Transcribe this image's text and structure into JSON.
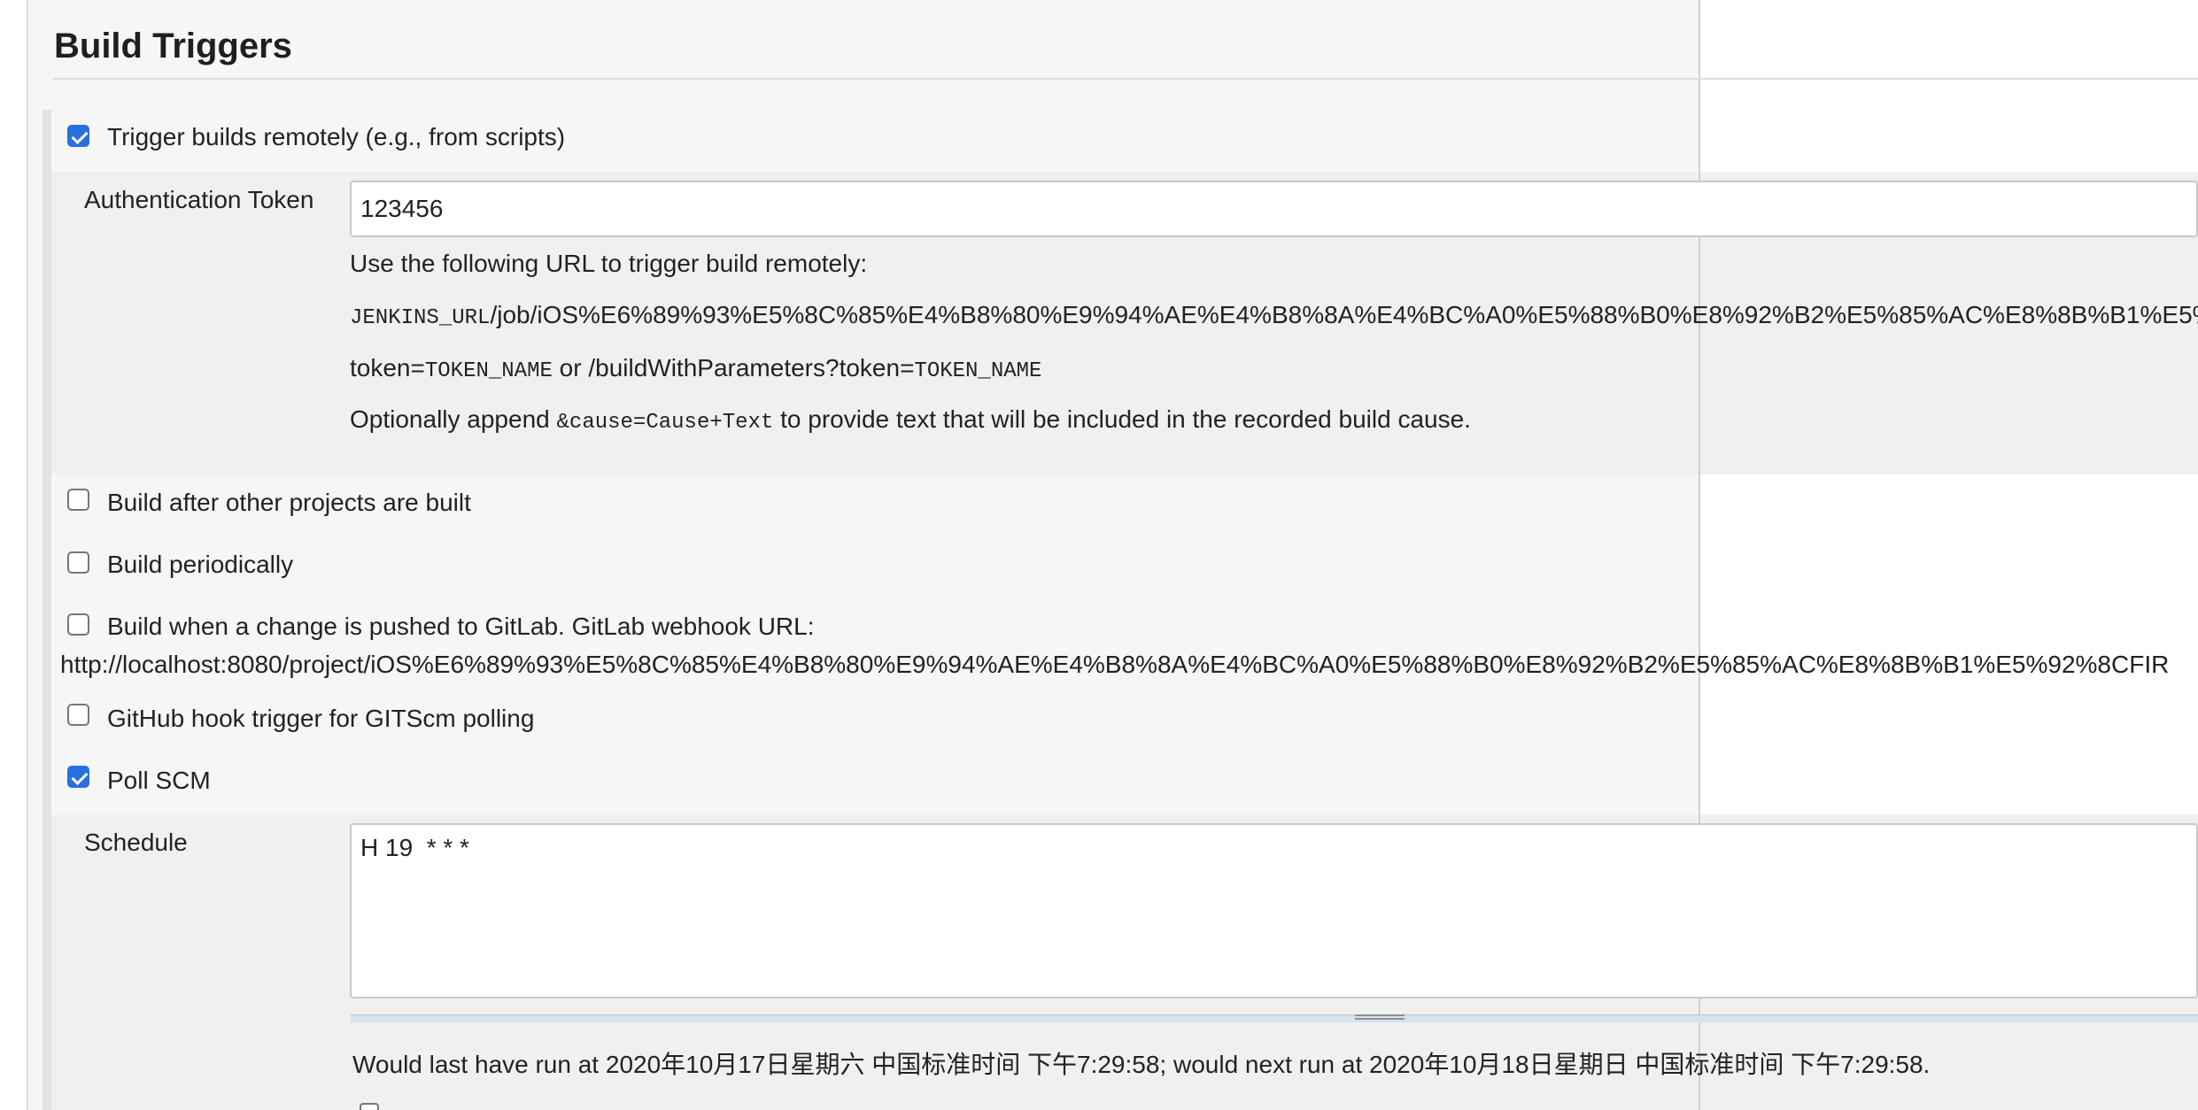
{
  "section": {
    "title": "Build Triggers"
  },
  "trigger_remote": {
    "label": "Trigger builds remotely (e.g., from scripts)",
    "checked": true,
    "auth_token_label": "Authentication Token",
    "auth_token_value": "123456",
    "help": {
      "line1": "Use the following URL to trigger build remotely:",
      "url_prefix": "JENKINS_URL",
      "url_path": "/job/iOS%E6%89%93%E5%8C%85%E4%B8%80%E9%94%AE%E4%B8%8A%E4%BC%A0%E5%88%B0%E8%92%B2%E5%85%AC%E8%8B%B1%E5%",
      "line3_a": "token=",
      "line3_b": "TOKEN_NAME",
      "line3_c": " or /buildWithParameters?token=",
      "line3_d": "TOKEN_NAME",
      "line4_a": "Optionally append ",
      "line4_b": "&cause=Cause+Text",
      "line4_c": " to provide text that will be included in the recorded build cause."
    }
  },
  "options": [
    {
      "label": "Build after other projects are built",
      "checked": false
    },
    {
      "label": "Build periodically",
      "checked": false
    },
    {
      "label": "Build when a change is pushed to GitLab. GitLab webhook URL:",
      "checked": false
    },
    {
      "label": "GitHub hook trigger for GITScm polling",
      "checked": false
    },
    {
      "label": "Poll SCM",
      "checked": true
    }
  ],
  "gitlab_webhook_url": "http://localhost:8080/project/iOS%E6%89%93%E5%8C%85%E4%B8%80%E9%94%AE%E4%B8%8A%E4%BC%A0%E5%88%B0%E8%92%B2%E5%85%AC%E8%8B%B1%E5%92%8CFIR",
  "schedule": {
    "label": "Schedule",
    "value": "H 19  * * *",
    "message": "Would last have run at 2020年10月17日星期六 中国标准时间 下午7:29:58; would next run at 2020年10月18日星期日 中国标准时间 下午7:29:58."
  }
}
